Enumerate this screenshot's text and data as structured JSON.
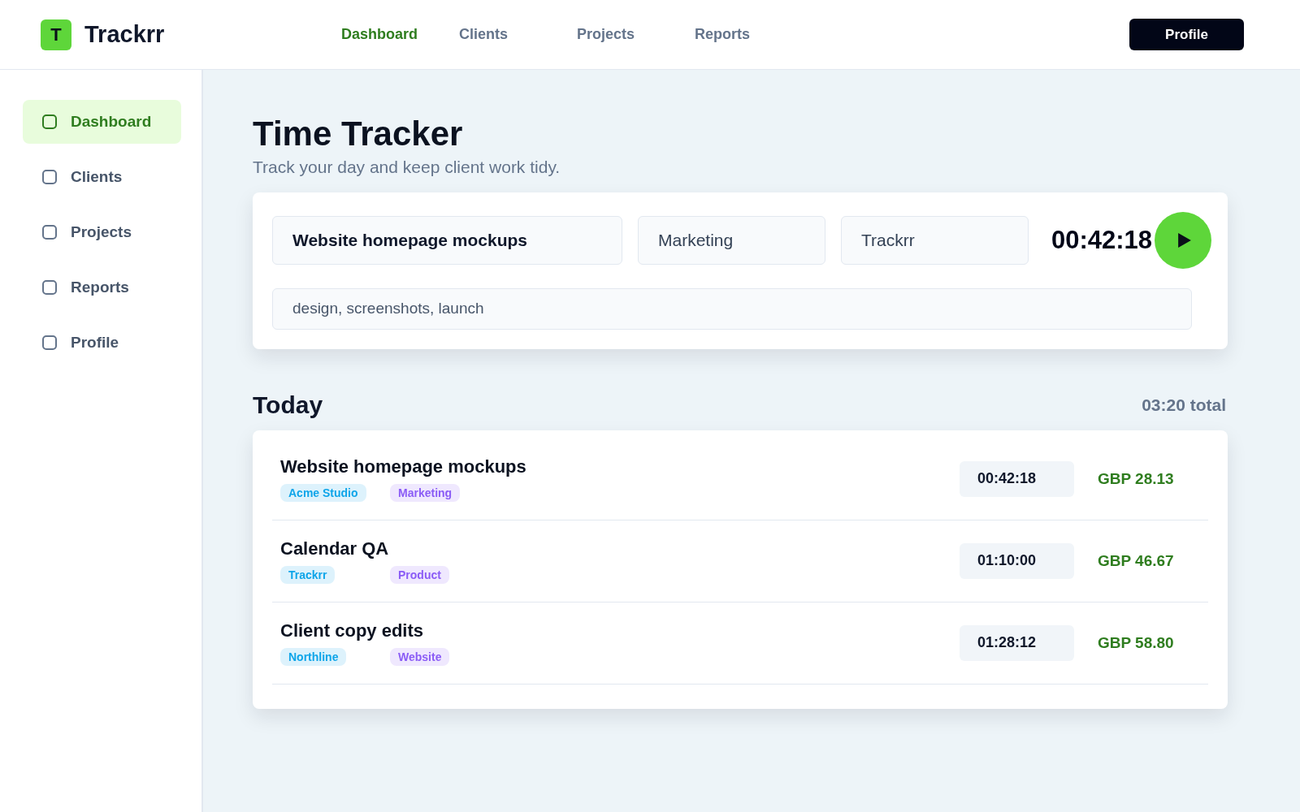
{
  "header": {
    "logo_letter": "T",
    "brand": "Trackrr",
    "nav": [
      {
        "label": "Dashboard",
        "selected": true
      },
      {
        "label": "Clients",
        "selected": false
      },
      {
        "label": "Projects",
        "selected": false
      },
      {
        "label": "Reports",
        "selected": false
      }
    ],
    "profile_button": "Profile"
  },
  "sidebar": {
    "items": [
      {
        "label": "Dashboard",
        "selected": true
      },
      {
        "label": "Clients",
        "selected": false
      },
      {
        "label": "Projects",
        "selected": false
      },
      {
        "label": "Reports",
        "selected": false
      },
      {
        "label": "Profile",
        "selected": false
      }
    ]
  },
  "page": {
    "title": "Time Tracker",
    "subtitle": "Track your day and keep client work tidy."
  },
  "timer_card": {
    "task": "Website homepage mockups",
    "category": "Marketing",
    "client": "Trackrr",
    "tags": "design, screenshots, launch",
    "elapsed": "00:42:18"
  },
  "today": {
    "heading": "Today",
    "total": "03:20 total",
    "entries": [
      {
        "title": "Website homepage mockups",
        "tags": [
          {
            "label": "Acme Studio",
            "color": "#0ea5e9"
          },
          {
            "label": "Marketing",
            "color": "#8b5cf6"
          }
        ],
        "duration": "00:42:18",
        "amount": "GBP 28.13"
      },
      {
        "title": "Calendar QA",
        "tags": [
          {
            "label": "Trackrr",
            "color": "#0ea5e9"
          },
          {
            "label": "Product",
            "color": "#8b5cf6"
          }
        ],
        "duration": "01:10:00",
        "amount": "GBP 46.67"
      },
      {
        "title": "Client copy edits",
        "tags": [
          {
            "label": "Northline",
            "color": "#0ea5e9"
          },
          {
            "label": "Website",
            "color": "#8b5cf6"
          }
        ],
        "duration": "01:28:12",
        "amount": "GBP 58.80"
      }
    ]
  }
}
